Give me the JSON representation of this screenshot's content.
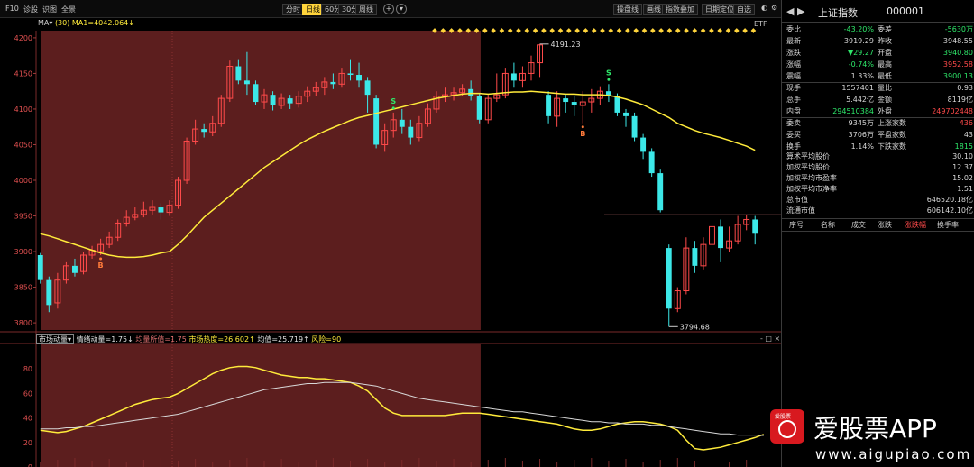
{
  "toolbar": {
    "left_labels": [
      "F10",
      "诊股",
      "识图",
      "全景"
    ],
    "periods": [
      "分时",
      "日线",
      "60分",
      "30分",
      "周线"
    ],
    "active_period": "日线",
    "add_symbol": "+",
    "right_buttons": [
      "操盘线",
      "画线",
      "指数叠加",
      "日期定位",
      "自选"
    ]
  },
  "chart": {
    "legend_prefix": "MA",
    "legend_param": "(30)",
    "legend_ma": "MA1=4042.064↓",
    "etf_label": "ETF",
    "y_ticks": [
      "4200",
      "4150",
      "4100",
      "4050",
      "4000",
      "3950",
      "3900",
      "3850",
      "3800"
    ],
    "high_label": "4191.23",
    "low_label": "3794.68",
    "signals": [
      {
        "text": "B",
        "color": "#ff7a3a"
      },
      {
        "text": "S",
        "color": "#2ee86a"
      },
      {
        "text": "B",
        "color": "#ff7a3a"
      },
      {
        "text": "S",
        "color": "#2ee86a"
      }
    ],
    "sub_indicator": {
      "name": "市场动量",
      "items": [
        {
          "text": "情绪动量=1.75↓",
          "cls": "w"
        },
        {
          "text": "均量所值=1.75",
          "cls": "dim"
        },
        {
          "text": "市场热度=26.602↑",
          "cls": "y"
        },
        {
          "text": "均值=25.719↑",
          "cls": "w"
        },
        {
          "text": "风险=90",
          "cls": "y"
        }
      ],
      "y_ticks": [
        "80",
        "60",
        "40",
        "20",
        "0"
      ],
      "controls": "- □ ×"
    }
  },
  "chart_data": {
    "type": "candlestick",
    "title": "",
    "ylim": [
      3790,
      4210
    ],
    "highlight_regions": [
      [
        0,
        50
      ]
    ],
    "candles": [
      [
        3895,
        3860,
        3898,
        3855
      ],
      [
        3860,
        3825,
        3865,
        3815
      ],
      [
        3828,
        3860,
        3870,
        3820
      ],
      [
        3860,
        3880,
        3885,
        3855
      ],
      [
        3880,
        3870,
        3890,
        3865
      ],
      [
        3872,
        3895,
        3900,
        3868
      ],
      [
        3895,
        3902,
        3908,
        3890
      ],
      [
        3900,
        3910,
        3918,
        3895
      ],
      [
        3910,
        3920,
        3928,
        3905
      ],
      [
        3920,
        3940,
        3945,
        3915
      ],
      [
        3940,
        3948,
        3958,
        3935
      ],
      [
        3948,
        3952,
        3962,
        3944
      ],
      [
        3952,
        3958,
        3970,
        3948
      ],
      [
        3958,
        3962,
        3972,
        3952
      ],
      [
        3962,
        3955,
        3968,
        3945
      ],
      [
        3955,
        3965,
        3972,
        3950
      ],
      [
        3965,
        4000,
        4005,
        3960
      ],
      [
        4000,
        4055,
        4060,
        3995
      ],
      [
        4055,
        4072,
        4085,
        4050
      ],
      [
        4072,
        4068,
        4080,
        4060
      ],
      [
        4068,
        4080,
        4090,
        4062
      ],
      [
        4080,
        4115,
        4120,
        4075
      ],
      [
        4115,
        4160,
        4168,
        4110
      ],
      [
        4160,
        4140,
        4170,
        4135
      ],
      [
        4140,
        4135,
        4180,
        4120
      ],
      [
        4135,
        4110,
        4140,
        4105
      ],
      [
        4110,
        4120,
        4128,
        4100
      ],
      [
        4120,
        4105,
        4125,
        4098
      ],
      [
        4105,
        4115,
        4122,
        4100
      ],
      [
        4115,
        4108,
        4120,
        4100
      ],
      [
        4108,
        4118,
        4125,
        4102
      ],
      [
        4118,
        4125,
        4132,
        4110
      ],
      [
        4125,
        4130,
        4138,
        4118
      ],
      [
        4130,
        4138,
        4145,
        4120
      ],
      [
        4138,
        4135,
        4150,
        4128
      ],
      [
        4135,
        4150,
        4158,
        4130
      ],
      [
        4150,
        4148,
        4170,
        4140
      ],
      [
        4148,
        4140,
        4165,
        4130
      ],
      [
        4140,
        4120,
        4145,
        4095
      ],
      [
        4115,
        4050,
        4120,
        4045
      ],
      [
        4050,
        4070,
        4080,
        4040
      ],
      [
        4070,
        4085,
        4095,
        4060
      ],
      [
        4085,
        4075,
        4100,
        4065
      ],
      [
        4075,
        4060,
        4085,
        4050
      ],
      [
        4060,
        4080,
        4090,
        4055
      ],
      [
        4080,
        4100,
        4108,
        4075
      ],
      [
        4100,
        4118,
        4125,
        4095
      ],
      [
        4118,
        4120,
        4130,
        4110
      ],
      [
        4120,
        4123,
        4130,
        4112
      ],
      [
        4123,
        4128,
        4135,
        4118
      ],
      [
        4128,
        4118,
        4140,
        4112
      ],
      [
        4118,
        4085,
        4122,
        4080
      ],
      [
        4085,
        4115,
        4120,
        4080
      ],
      [
        4115,
        4120,
        4150,
        4110
      ],
      [
        4120,
        4150,
        4158,
        4115
      ],
      [
        4150,
        4140,
        4165,
        4130
      ],
      [
        4140,
        4150,
        4160,
        4130
      ],
      [
        4150,
        4165,
        4175,
        4140
      ],
      [
        4165,
        4190,
        4191.23,
        4145
      ],
      [
        4120,
        4090,
        4125,
        4080
      ],
      [
        4090,
        4115,
        4125,
        4075
      ],
      [
        4115,
        4110,
        4120,
        4095
      ],
      [
        4110,
        4105,
        4118,
        4090
      ],
      [
        4105,
        4110,
        4125,
        4080
      ],
      [
        4110,
        4115,
        4128,
        4095
      ],
      [
        4115,
        4125,
        4132,
        4105
      ],
      [
        4125,
        4118,
        4135,
        4110
      ],
      [
        4118,
        4095,
        4122,
        4090
      ],
      [
        4095,
        4090,
        4100,
        4075
      ],
      [
        4090,
        4060,
        4095,
        4055
      ],
      [
        4060,
        4040,
        4065,
        4030
      ],
      [
        4040,
        4010,
        4045,
        4005
      ],
      [
        4010,
        3958,
        4015,
        3955
      ],
      [
        3905,
        3820,
        3910,
        3794.68
      ],
      [
        3820,
        3845,
        3850,
        3815
      ],
      [
        3845,
        3905,
        3920,
        3840
      ],
      [
        3905,
        3880,
        3915,
        3870
      ],
      [
        3880,
        3910,
        3920,
        3875
      ],
      [
        3910,
        3935,
        3940,
        3905
      ],
      [
        3935,
        3905,
        3945,
        3885
      ],
      [
        3905,
        3915,
        3935,
        3900
      ],
      [
        3915,
        3938,
        3950,
        3910
      ],
      [
        3938,
        3945,
        3952,
        3930
      ],
      [
        3945,
        3925,
        3950,
        3910
      ]
    ],
    "ma30": [
      3925,
      3922,
      3918,
      3914,
      3910,
      3906,
      3902,
      3898,
      3895,
      3893,
      3892,
      3892,
      3893,
      3895,
      3898,
      3900,
      3910,
      3922,
      3935,
      3948,
      3958,
      3968,
      3978,
      3988,
      3998,
      4008,
      4018,
      4026,
      4034,
      4042,
      4050,
      4057,
      4063,
      4069,
      4074,
      4079,
      4084,
      4088,
      4091,
      4094,
      4097,
      4100,
      4103,
      4106,
      4109,
      4112,
      4115,
      4117,
      4119,
      4121,
      4122,
      4122,
      4121,
      4122,
      4123,
      4124,
      4124,
      4125,
      4124,
      4123,
      4122,
      4121,
      4121,
      4120,
      4120,
      4120,
      4119,
      4117,
      4114,
      4110,
      4106,
      4100,
      4094,
      4088,
      4080,
      4075,
      4070,
      4066,
      4063,
      4060,
      4056,
      4052,
      4048,
      4042.064
    ],
    "sub_ylim": [
      0,
      100
    ],
    "market_heat": [
      30,
      29,
      28,
      29,
      31,
      33,
      36,
      39,
      42,
      45,
      48,
      51,
      53,
      55,
      56,
      57,
      60,
      64,
      68,
      72,
      76,
      79,
      81,
      82,
      82,
      81,
      79,
      77,
      75,
      74,
      73,
      73,
      72,
      72,
      71,
      70,
      69,
      66,
      62,
      55,
      48,
      44,
      42,
      42,
      42,
      42,
      42,
      42,
      43,
      44,
      44,
      44,
      43,
      42,
      41,
      40,
      39,
      38,
      37,
      36,
      35,
      33,
      31,
      30,
      30,
      31,
      33,
      35,
      36,
      37,
      37,
      36,
      35,
      33,
      30,
      22,
      15,
      14,
      15,
      16,
      18,
      20,
      22,
      24,
      26.602
    ],
    "avg": [
      31,
      31,
      31,
      32,
      32,
      33,
      33,
      34,
      35,
      36,
      37,
      38,
      39,
      40,
      41,
      42,
      43,
      45,
      47,
      49,
      51,
      53,
      55,
      57,
      59,
      61,
      63,
      64,
      65,
      66,
      67,
      68,
      68,
      69,
      69,
      69,
      69,
      68,
      67,
      66,
      64,
      62,
      60,
      58,
      56,
      55,
      54,
      53,
      52,
      51,
      50,
      49,
      48,
      47,
      46,
      45,
      45,
      44,
      43,
      42,
      41,
      40,
      39,
      38,
      37,
      37,
      36,
      36,
      35,
      35,
      35,
      34,
      34,
      33,
      32,
      31,
      30,
      29,
      28,
      27,
      27,
      26,
      26,
      26,
      25.719
    ]
  },
  "panel": {
    "nav": "◀ ▶",
    "title": "上证指数",
    "code": "000001",
    "quotes": [
      {
        "l": "委比",
        "v": "-43.20%",
        "vc": "green",
        "l2": "委差",
        "v2": "-5630万",
        "v2c": "green"
      },
      {
        "l": "最新",
        "v": "3919.29",
        "vc": "white",
        "l2": "昨收",
        "v2": "3948.55",
        "v2c": "white"
      },
      {
        "l": "涨跌",
        "v": "▼29.27",
        "vc": "green",
        "l2": "开盘",
        "v2": "3940.80",
        "v2c": "green"
      },
      {
        "l": "涨幅",
        "v": "-0.74%",
        "vc": "green",
        "l2": "最高",
        "v2": "3952.58",
        "v2c": "red"
      },
      {
        "l": "震幅",
        "v": "1.33%",
        "vc": "white",
        "l2": "最低",
        "v2": "3900.13",
        "v2c": "green"
      },
      {
        "l": "现手",
        "v": "1557401",
        "vc": "white",
        "l2": "量比",
        "v2": "0.93",
        "v2c": "white"
      },
      {
        "l": "总手",
        "v": "5.442亿",
        "vc": "white",
        "l2": "金额",
        "v2": "8119亿",
        "v2c": "white"
      },
      {
        "l": "内盘",
        "v": "294510384",
        "vc": "green",
        "l2": "外盘",
        "v2": "249702448",
        "v2c": "red"
      },
      {
        "l": "委卖",
        "v": "9345万",
        "vc": "white",
        "l2": "上涨家数",
        "v2": "436",
        "v2c": "red"
      },
      {
        "l": "委买",
        "v": "3706万",
        "vc": "white",
        "l2": "平盘家数",
        "v2": "43",
        "v2c": "white"
      },
      {
        "l": "换手",
        "v": "1.14%",
        "vc": "white",
        "l2": "下跌家数",
        "v2": "1815",
        "v2c": "green"
      }
    ],
    "stats": [
      {
        "l": "算术平均股价",
        "v": "30.10"
      },
      {
        "l": "加权平均股价",
        "v": "12.37"
      },
      {
        "l": "加权平均市盈率",
        "v": "15.02"
      },
      {
        "l": "加权平均市净率",
        "v": "1.51"
      },
      {
        "l": "总市值",
        "v": "646520.18亿"
      },
      {
        "l": "流通市值",
        "v": "606142.10亿"
      }
    ],
    "table_headers": [
      "序号",
      "名称",
      "成交",
      "涨跌",
      "涨跌幅",
      "换手率"
    ],
    "active_header": "涨跌幅"
  },
  "watermark": {
    "logo_caption": "爱股票",
    "name": "爱股票APP",
    "url": "www.aigupiao.com"
  }
}
